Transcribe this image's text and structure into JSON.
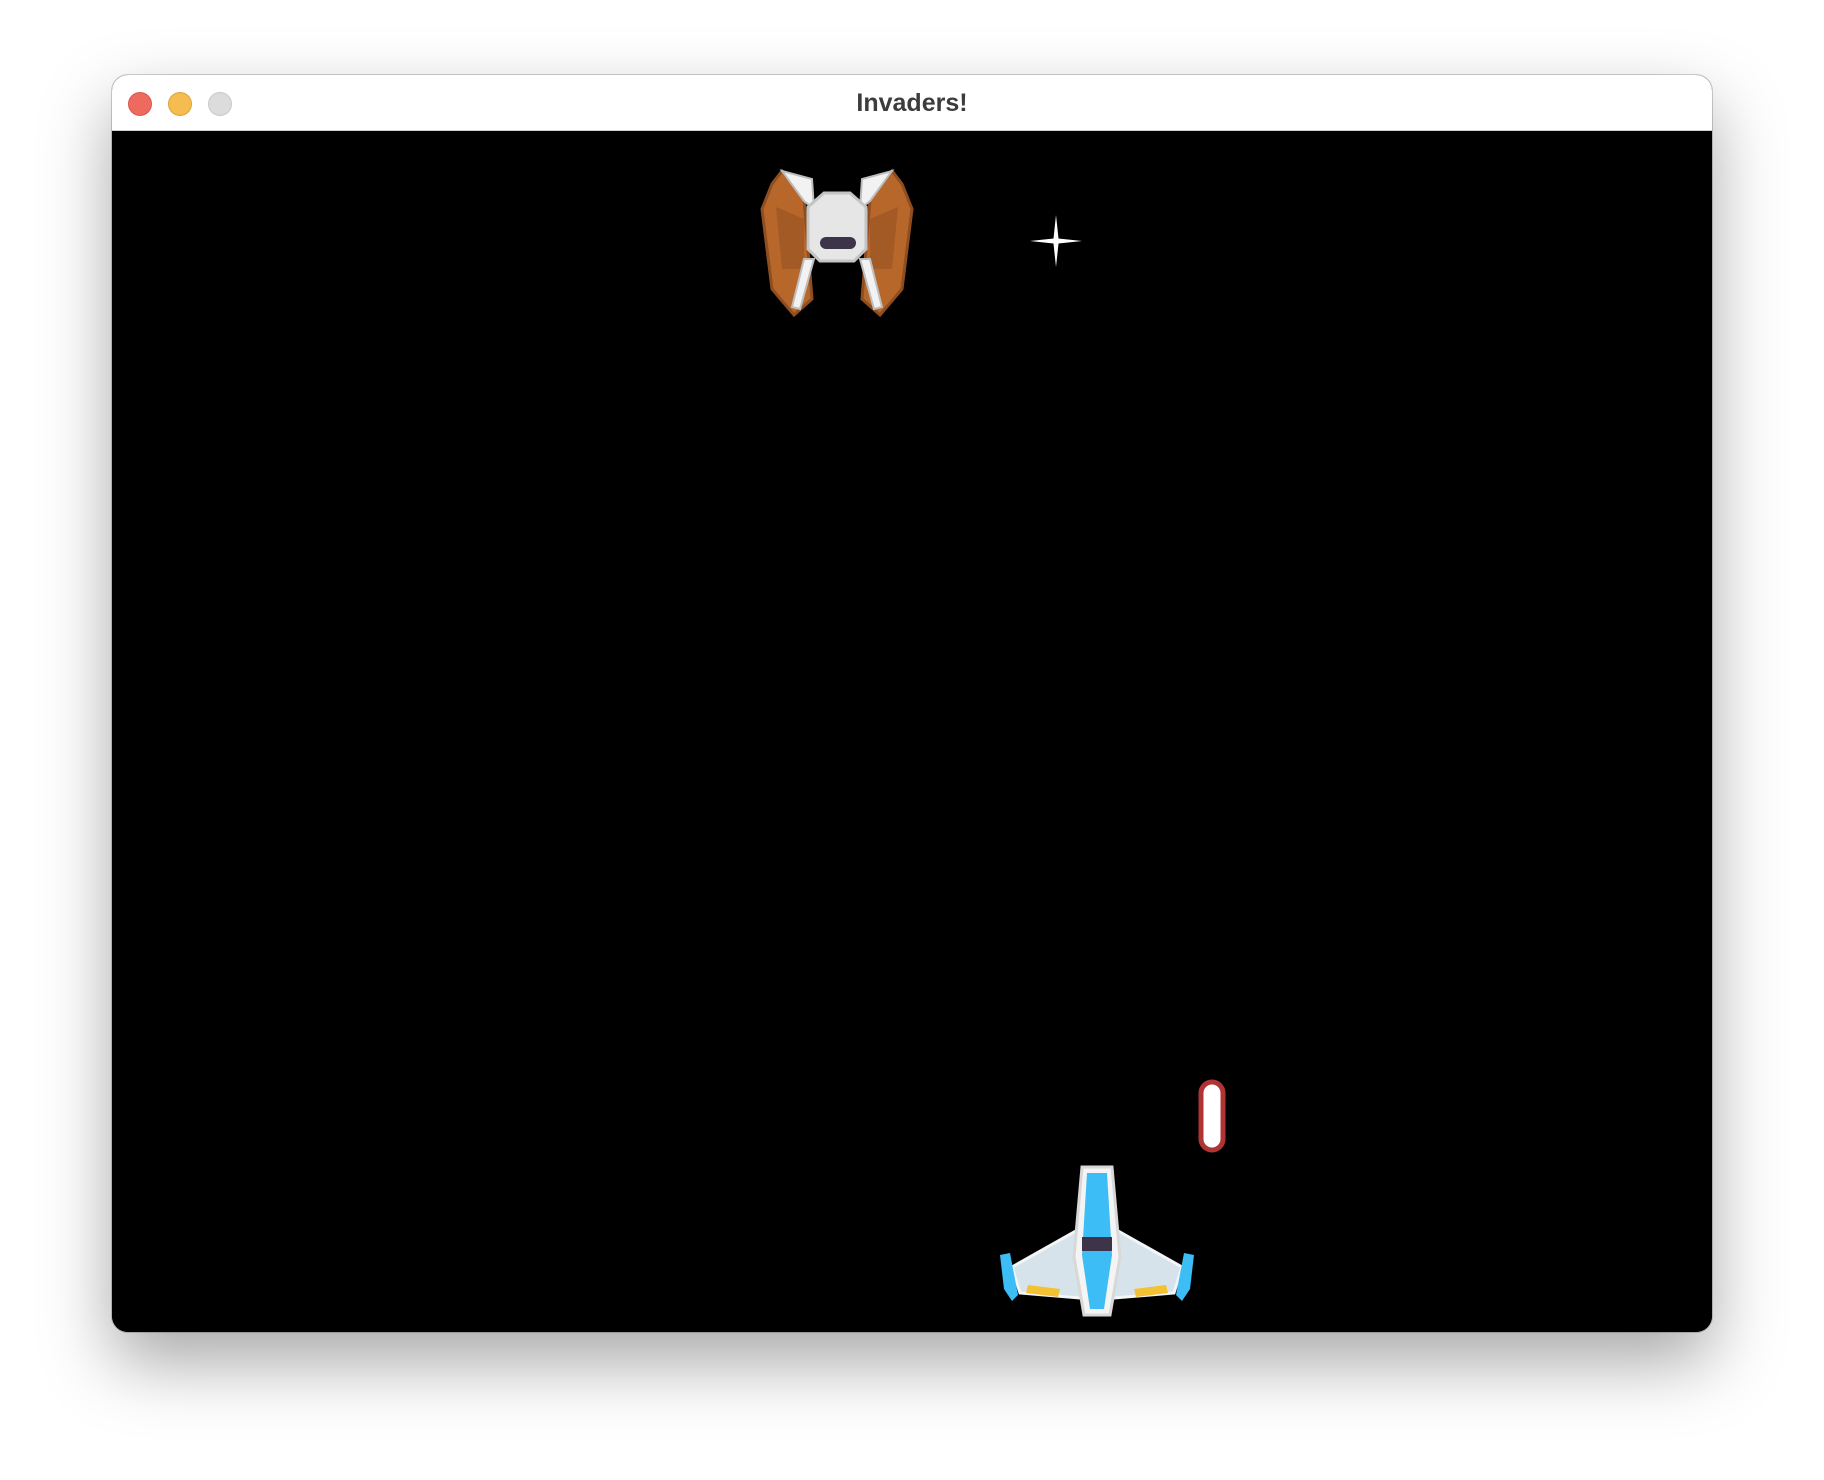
{
  "window": {
    "title": "Invaders!"
  },
  "controls": {
    "close": "close-button",
    "minimize": "minimize-button",
    "zoom": "zoom-button"
  },
  "colors": {
    "background": "#000000",
    "player_body": "#d7e3ea",
    "player_accent": "#3dbdf5",
    "enemy_wing": "#b8672b",
    "enemy_body": "#e3e3e3",
    "bullet_outline": "#b03434"
  },
  "sprites": {
    "enemy": "enemy-ship",
    "star": "star-sparkle",
    "bullet": "laser-bullet",
    "player": "player-ship"
  }
}
